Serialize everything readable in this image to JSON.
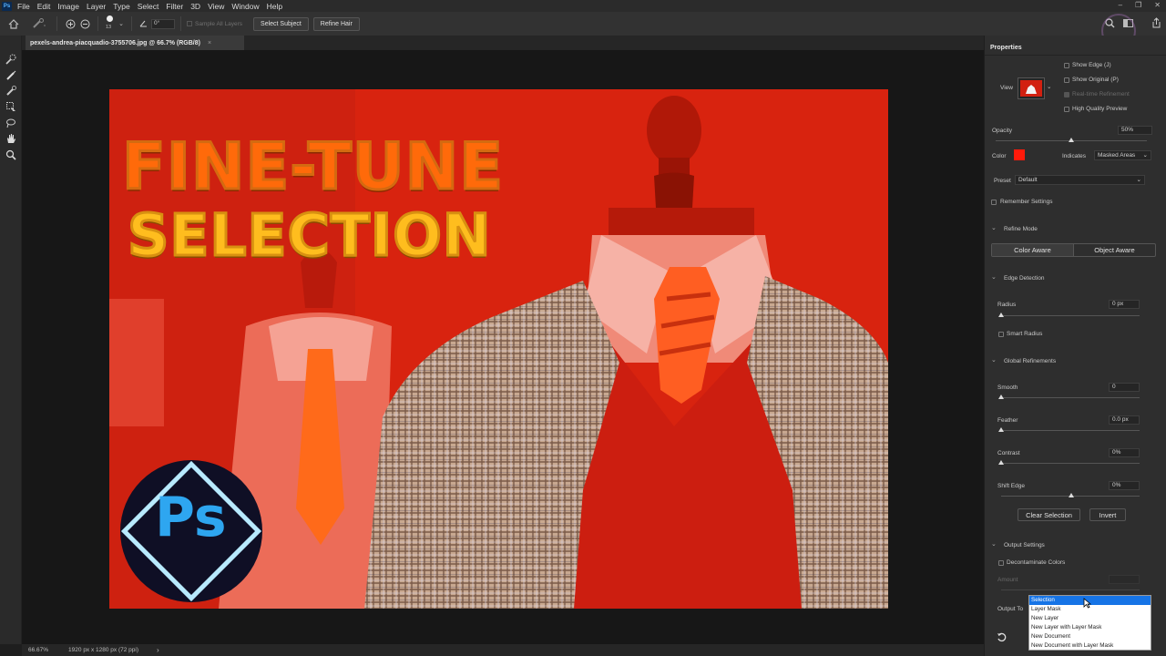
{
  "app": {
    "logo": "Ps"
  },
  "menu": [
    "File",
    "Edit",
    "Image",
    "Layer",
    "Type",
    "Select",
    "Filter",
    "3D",
    "View",
    "Window",
    "Help"
  ],
  "window_controls": {
    "minimize": "–",
    "restore": "❐",
    "close": "✕"
  },
  "options_bar": {
    "brush_size": "13",
    "angle": "0°",
    "sample_all_layers": "Sample All Layers",
    "select_subject": "Select Subject",
    "refine_hair": "Refine Hair"
  },
  "document": {
    "tab_title": "pexels-andrea-piacquadio-3755706.jpg @ 66.7% (RGB/8)",
    "close": "×"
  },
  "canvas": {
    "headline_line1": "FINE-TUNE",
    "headline_line2": "SELECTION",
    "badge_text": "Ps"
  },
  "status_bar": {
    "zoom": "66.67%",
    "doc_info": "1920 px x 1280 px (72 ppi)",
    "arrow": "›"
  },
  "properties": {
    "tab": "Properties",
    "view_label": "View",
    "show_edge": "Show Edge (J)",
    "show_original": "Show Original (P)",
    "realtime_refinement": "Real-time Refinement",
    "high_quality_preview": "High Quality Preview",
    "opacity_label": "Opacity",
    "opacity_value": "50%",
    "opacity_level": 0.5,
    "color_label": "Color",
    "color_swatch": "#ff1a0a",
    "indicates_label": "Indicates",
    "indicates_value": "Masked Areas",
    "preset_label": "Preset",
    "preset_value": "Default",
    "remember_settings": "Remember Settings",
    "refine_mode": {
      "title": "Refine Mode",
      "color_aware": "Color Aware",
      "object_aware": "Object Aware"
    },
    "edge_detection": {
      "title": "Edge Detection",
      "radius_label": "Radius",
      "radius_value": "0 px",
      "smart_radius": "Smart Radius"
    },
    "global_refinements": {
      "title": "Global Refinements",
      "smooth_label": "Smooth",
      "smooth_value": "0",
      "feather_label": "Feather",
      "feather_value": "0.0 px",
      "contrast_label": "Contrast",
      "contrast_value": "0%",
      "shift_edge_label": "Shift Edge",
      "shift_edge_value": "0%"
    },
    "clear_selection": "Clear Selection",
    "invert": "Invert",
    "output_settings": {
      "title": "Output Settings",
      "decontaminate": "Decontaminate Colors",
      "amount_label": "Amount",
      "output_to_label": "Output To",
      "options": [
        "Selection",
        "Layer Mask",
        "New Layer",
        "New Layer with Layer Mask",
        "New Document",
        "New Document with Layer Mask"
      ],
      "selected": "Selection"
    }
  }
}
